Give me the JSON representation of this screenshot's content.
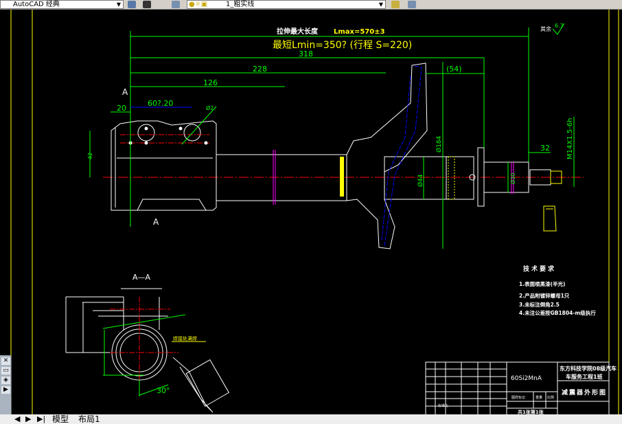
{
  "toolbar": {
    "workspace": "AutoCAD 经典",
    "layer": "1_粗实线"
  },
  "tabs": [
    "模型",
    "布局1"
  ],
  "colors": {
    "outline": "#ffffff",
    "dimension": "#00ff00",
    "centerline": "#ff0000",
    "hidden": "#0000ff",
    "accent": "#ffff00",
    "section": "#ff00ff"
  },
  "drawing": {
    "max_length_label": "拉伸最大长度",
    "lmax": "Lmax=570±3",
    "lmin": "最短Lmin=350? (行程 S=220)",
    "dims": {
      "d318": "318",
      "d228": "228",
      "d126": "126",
      "d20": "20",
      "d607": "60?.20",
      "d42": "42",
      "d54": "(54)",
      "d184": "Ø184",
      "d44": "Ø44",
      "d30": "Ø30",
      "d32": "32",
      "thread": "M14X1.5-6h",
      "hole": "Ø2"
    },
    "roughness": {
      "label": "其余",
      "value": "6.3"
    },
    "section_mark": "A",
    "section_title": "A—A",
    "angle": "30°",
    "weld_note": "焊接处满焊",
    "tech_title": "技术要求",
    "tech_items": [
      "1.表面喷黑漆(半光)",
      "2.产品附镀锌螺母1只",
      "3.未标注倒角2.5",
      "4.未注公差按GB1804-m级执行"
    ]
  },
  "title_block": {
    "material": "60Si2MnA",
    "school": "东方科技学院08级汽车",
    "class": "车服务工程1班",
    "drawing_name": "减震器外形图",
    "scale_label": "图样标记",
    "weight_label": "重量",
    "ratio_label": "比例",
    "sheet": "共1张第1张",
    "std": "标准化"
  }
}
